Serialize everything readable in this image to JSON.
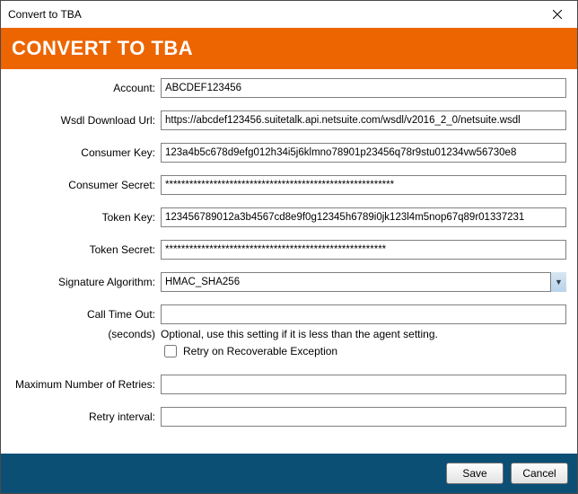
{
  "window": {
    "title": "Convert to TBA"
  },
  "banner": {
    "heading": "CONVERT TO TBA"
  },
  "form": {
    "account": {
      "label": "Account:",
      "value": "ABCDEF123456"
    },
    "wsdl": {
      "label": "Wsdl Download Url:",
      "value": "https://abcdef123456.suitetalk.api.netsuite.com/wsdl/v2016_2_0/netsuite.wsdl"
    },
    "consumer_key": {
      "label": "Consumer Key:",
      "value": "123a4b5c678d9efg012h34i5j6klmno78901p23456q78r9stu01234vw56730e8"
    },
    "consumer_secret": {
      "label": "Consumer Secret:",
      "value": "*********************************************************"
    },
    "token_key": {
      "label": "Token Key:",
      "value": "123456789012a3b4567cd8e9f0g12345h6789i0jk123l4m5nop67q89r01337231"
    },
    "token_secret": {
      "label": "Token Secret:",
      "value": "*******************************************************"
    },
    "sig_alg": {
      "label": "Signature Algorithm:",
      "selected": "HMAC_SHA256"
    },
    "call_timeout": {
      "label": "Call Time Out:",
      "value": ""
    },
    "timeout_unit_label": "(seconds)",
    "timeout_hint": "Optional, use this setting if it is less than the agent setting.",
    "retry_checkbox_label": "Retry on Recoverable Exception",
    "retry_checked": false,
    "max_retries": {
      "label": "Maximum Number of Retries:",
      "value": ""
    },
    "retry_interval": {
      "label": "Retry interval:",
      "value": ""
    }
  },
  "footer": {
    "save": "Save",
    "cancel": "Cancel"
  }
}
